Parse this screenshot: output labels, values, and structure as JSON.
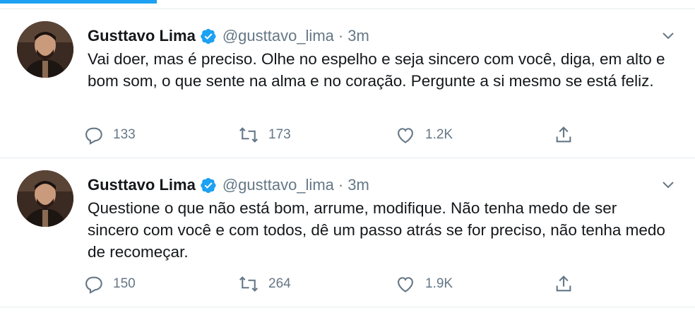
{
  "tweets": [
    {
      "author": {
        "name": "Gusttavo Lima",
        "handle": "@gusttavo_lima",
        "verified": true,
        "avatar_icon": "profile-photo"
      },
      "separator": "·",
      "time": "3m",
      "text": "Vai doer, mas é preciso. Olhe no espelho e seja sincero com você, diga, em alto e bom som, o que sente na alma e no coração. Pergunte a si mesmo se está feliz.",
      "stats": {
        "replies": "133",
        "retweets": "173",
        "likes": "1.2K"
      }
    },
    {
      "author": {
        "name": "Gusttavo Lima",
        "handle": "@gusttavo_lima",
        "verified": true,
        "avatar_icon": "profile-photo"
      },
      "separator": "·",
      "time": "3m",
      "text": "Questione o que não está bom, arrume, modifique. Não tenha medo de ser sincero com você e com todos, dê um passo atrás se for preciso, não tenha medo de recomeçar.",
      "stats": {
        "replies": "150",
        "retweets": "264",
        "likes": "1.9K"
      }
    }
  ],
  "colors": {
    "accent": "#1da1f2",
    "text": "#14171a",
    "secondary": "#657786",
    "divider": "#e6ecf0"
  },
  "icons": [
    "verified-badge-icon",
    "chevron-down-icon",
    "reply-icon",
    "retweet-icon",
    "like-icon",
    "share-icon"
  ]
}
